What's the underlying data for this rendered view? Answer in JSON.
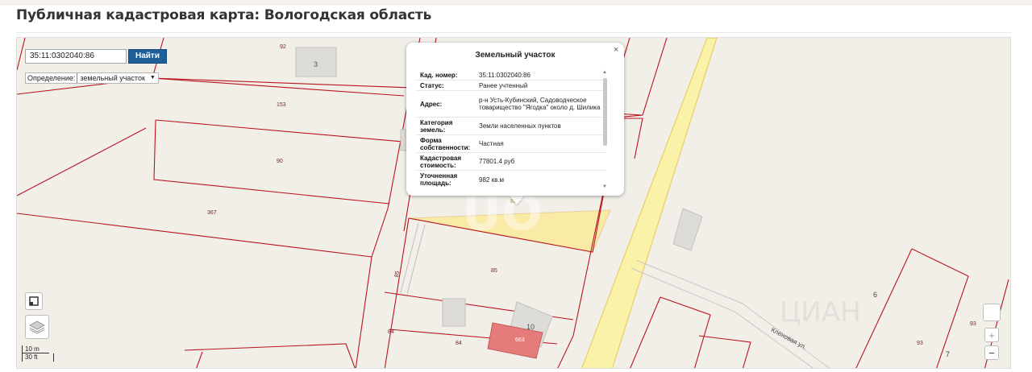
{
  "page": {
    "title": "Публичная кадастровая карта: Вологодская область"
  },
  "search": {
    "value": "35:11:0302040:86",
    "button_label": "Найти"
  },
  "definition": {
    "label": "Определение:",
    "selected": "земельный участок"
  },
  "popup": {
    "title": "Земельный участок",
    "close_symbol": "×",
    "rows": [
      {
        "key": "Кад. номер:",
        "value": "35:11:0302040:86"
      },
      {
        "key": "Статус:",
        "value": "Ранее учтенный"
      },
      {
        "key": "Адрес:",
        "value": "р-н Усть-Кубинский, Садоводческое товарищество \"Ягодка\" около д. Шилика"
      },
      {
        "key": "Категория земель:",
        "value": "Земли населенных пунктов"
      },
      {
        "key": "Форма собственности:",
        "value": "Частная"
      },
      {
        "key": "Кадастровая стоимость:",
        "value": "77801.4 руб"
      },
      {
        "key": "Уточненная площадь:",
        "value": "982 кв.м"
      }
    ]
  },
  "map": {
    "parcel_labels": [
      "92",
      "153",
      "90",
      "367",
      "85",
      "85",
      "84",
      "84",
      "86",
      "6",
      "93",
      "93",
      "7"
    ],
    "building_labels": [
      "3",
      "10",
      "663"
    ],
    "street_name": "Кленовая ул.",
    "watermark": "ЦИАН",
    "colors": {
      "background": "#f2efe9",
      "parcel_border": "#b8141f",
      "selected_parcel": "#f9eaa6",
      "road": "#fbf2a9",
      "road_edge": "#e7cf62",
      "building": "#dedcd8",
      "building_highlight": "#e57b7b"
    }
  },
  "controls": {
    "zoom_in": "+",
    "zoom_out": "−",
    "layers_icon": "layers-icon",
    "fullscreen_icon": "fullscreen-icon"
  },
  "scale": {
    "meters": "10 m",
    "feet": "30 ft"
  }
}
